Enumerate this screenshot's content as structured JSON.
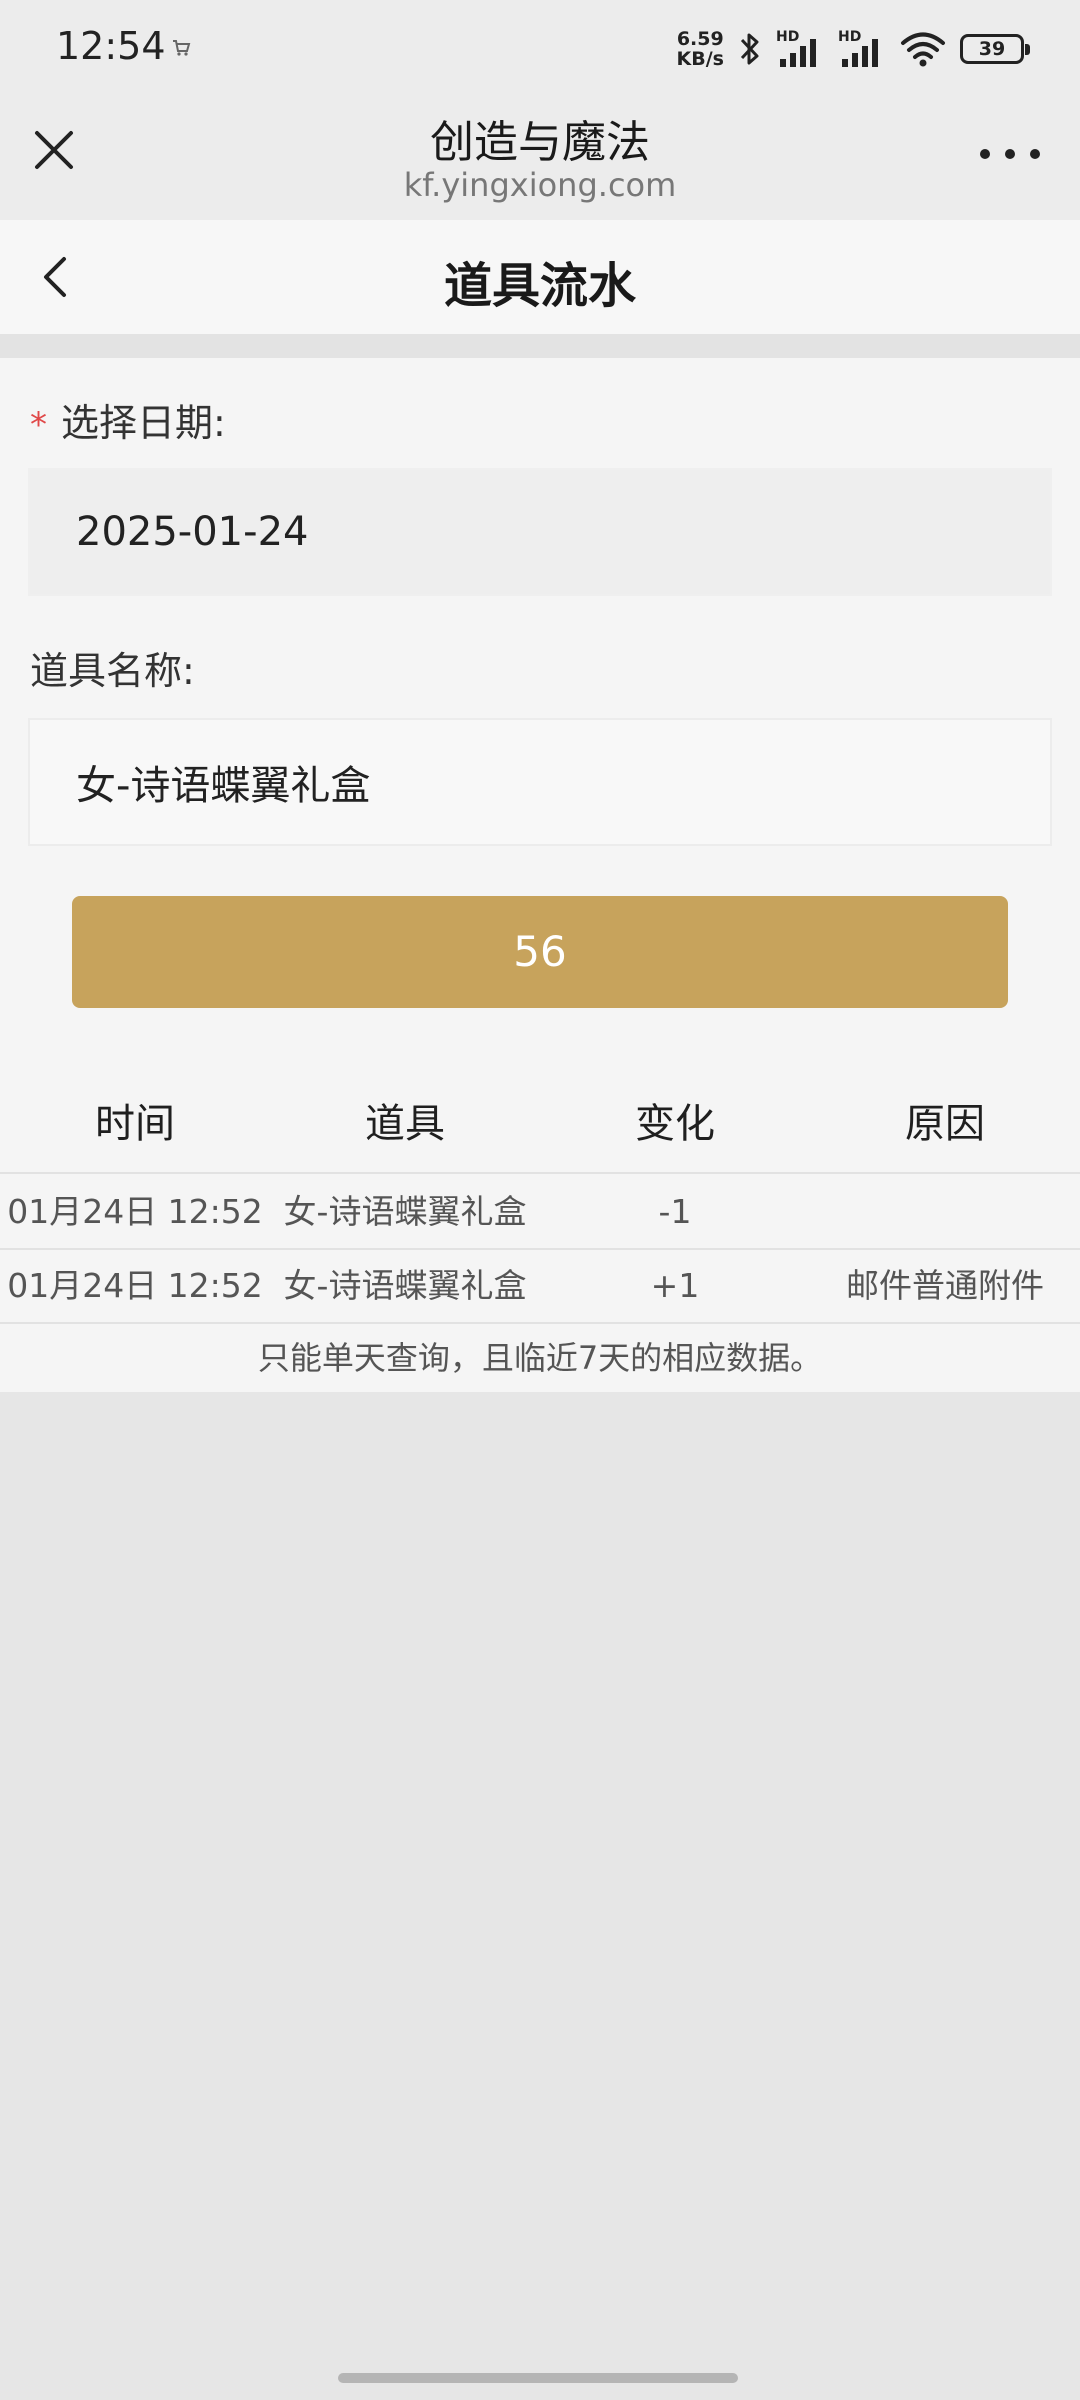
{
  "status_bar": {
    "time": "12:54",
    "net_speed_value": "6.59",
    "net_speed_unit": "KB/s",
    "signal_1_label": "HD",
    "signal_2_label": "HD",
    "battery": "39"
  },
  "browser": {
    "title": "创造与魔法",
    "url": "kf.yingxiong.com"
  },
  "page": {
    "title": "道具流水"
  },
  "form": {
    "date_label": "选择日期:",
    "date_required_mark": "*",
    "date_value": "2025-01-24",
    "item_label": "道具名称:",
    "item_value": "女-诗语蝶翼礼盒",
    "button_label": "56"
  },
  "table": {
    "headers": [
      "时间",
      "道具",
      "变化",
      "原因"
    ],
    "rows": [
      [
        "01月24日 12:52",
        "女-诗语蝶翼礼盒",
        "-1",
        ""
      ],
      [
        "01月24日 12:52",
        "女-诗语蝶翼礼盒",
        "+1",
        "邮件普通附件"
      ]
    ]
  },
  "note": "只能单天查询，且临近7天的相应数据。",
  "colors": {
    "accent": "#c7a35c",
    "required": "#e04848"
  }
}
